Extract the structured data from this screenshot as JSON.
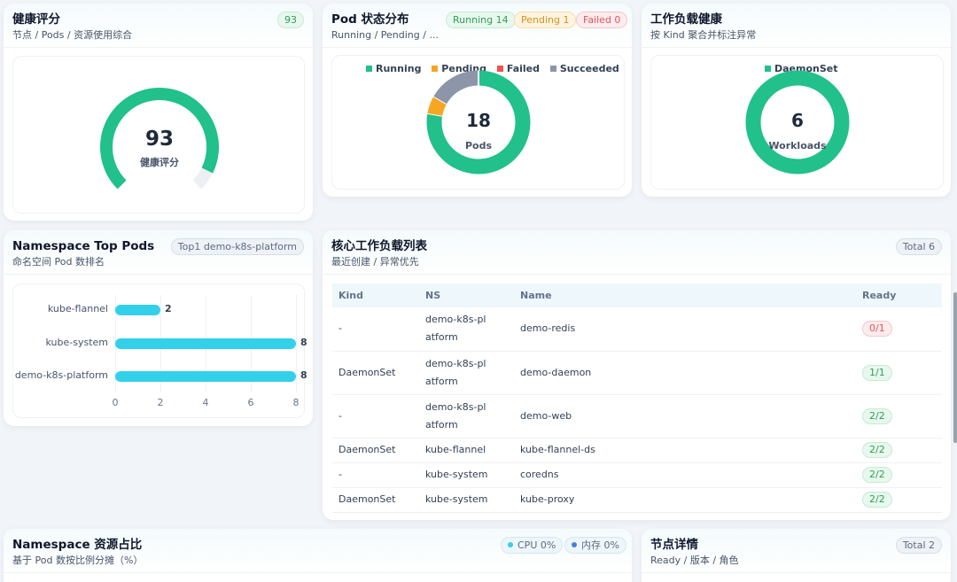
{
  "health": {
    "title": "健康评分",
    "subtitle": "节点 / Pods / 资源使用综合",
    "badge": "93",
    "score": 93,
    "score_label": "健康评分",
    "gauge_color": "#22c08a"
  },
  "pod_status": {
    "title": "Pod 状态分布",
    "subtitle": "Running / Pending / ...",
    "badges": [
      "Running 14",
      "Pending 1",
      "Failed 0"
    ],
    "legend": [
      {
        "name": "Running",
        "color": "#22c08a"
      },
      {
        "name": "Pending",
        "color": "#f5a623"
      },
      {
        "name": "Failed",
        "color": "#ef5350"
      },
      {
        "name": "Succeeded",
        "color": "#8c96a8"
      }
    ],
    "center_value": "18",
    "center_label": "Pods"
  },
  "workload_health": {
    "title": "工作负载健康",
    "subtitle": "按 Kind 聚合并标注异常",
    "legend": [
      {
        "name": "DaemonSet",
        "color": "#22c08a"
      }
    ],
    "center_value": "6",
    "center_label": "Workloads"
  },
  "ns_top": {
    "title": "Namespace Top Pods",
    "subtitle": "命名空间 Pod 数排名",
    "badge": "Top1 demo-k8s-platform",
    "bar_color": "#33d0ea"
  },
  "workloads": {
    "title": "核心工作负载列表",
    "subtitle": "最近创建 / 异常优先",
    "badge": "Total 6",
    "columns": [
      "Kind",
      "NS",
      "Name",
      "Ready"
    ],
    "rows": [
      {
        "kind": "-",
        "ns": "demo-k8s-platform",
        "name": "demo-redis",
        "ready": "0/1",
        "ok": false
      },
      {
        "kind": "DaemonSet",
        "ns": "demo-k8s-platform",
        "name": "demo-daemon",
        "ready": "1/1",
        "ok": true
      },
      {
        "kind": "-",
        "ns": "demo-k8s-platform",
        "name": "demo-web",
        "ready": "2/2",
        "ok": true
      },
      {
        "kind": "DaemonSet",
        "ns": "kube-flannel",
        "name": "kube-flannel-ds",
        "ready": "2/2",
        "ok": true
      },
      {
        "kind": "-",
        "ns": "kube-system",
        "name": "coredns",
        "ready": "2/2",
        "ok": true
      },
      {
        "kind": "DaemonSet",
        "ns": "kube-system",
        "name": "kube-proxy",
        "ready": "2/2",
        "ok": true
      }
    ]
  },
  "ns_resource": {
    "title": "Namespace 资源占比",
    "subtitle": "基于 Pod 数按比例分摊（%）",
    "badges": [
      {
        "label": "CPU 0%",
        "color": "#33d0ea"
      },
      {
        "label": "内存 0%",
        "color": "#4a7fe0"
      }
    ]
  },
  "node_detail": {
    "title": "节点详情",
    "subtitle": "Ready / 版本 / 角色",
    "badge": "Total 2"
  },
  "chart_data": [
    {
      "type": "pie",
      "categories": [
        "Running",
        "Pending",
        "Failed",
        "Succeeded"
      ],
      "values": [
        14,
        1,
        0,
        3
      ]
    },
    {
      "type": "pie",
      "categories": [
        "DaemonSet"
      ],
      "values": [
        6
      ]
    },
    {
      "type": "bar",
      "orientation": "horizontal",
      "categories": [
        "kube-flannel",
        "kube-system",
        "demo-k8s-platform"
      ],
      "values": [
        2,
        8,
        8
      ],
      "xlim": [
        0,
        8
      ],
      "xticks": [
        0,
        2,
        4,
        6,
        8
      ],
      "grid": true
    }
  ]
}
